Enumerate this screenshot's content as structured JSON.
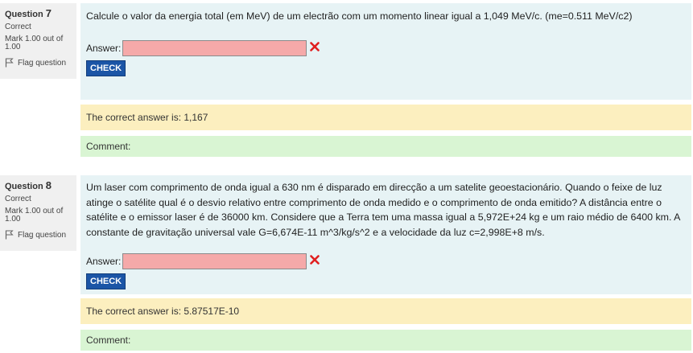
{
  "questions": [
    {
      "label": "Question",
      "number": "7",
      "state": "Correct",
      "grade": "Mark 1.00 out of 1.00",
      "flag_label": "Flag question",
      "text": "Calcule o valor da energia total (em MeV) de um electrão com um momento linear igual a 1,049 MeV/c. (me=0.511 MeV/c2)",
      "answer_label": "Answer:",
      "answer_value": "",
      "check_label": "CHECK",
      "correct_answer": "The correct answer is: 1,167",
      "comment": "Comment:"
    },
    {
      "label": "Question",
      "number": "8",
      "state": "Correct",
      "grade": "Mark 1.00 out of 1.00",
      "flag_label": "Flag question",
      "text": "Um laser com comprimento de onda igual a 630 nm é disparado em direcção a um satelite geoestacionário. Quando o feixe de luz atinge o satélite qual é o desvio relativo entre comprimento de onda medido e o comprimento de onda emitido? A distância entre o satélite e o emissor laser é de 36000 km. Considere que a Terra tem uma massa igual a 5,972E+24 kg e um raio médio de 6400 km. A constante de gravitação universal vale G=6,674E-11 m^3/kg/s^2 e a velocidade da luz c=2,998E+8 m/s.",
      "answer_label": "Answer:",
      "answer_value": "",
      "check_label": "CHECK",
      "correct_answer": "The correct answer is: 5.87517E-10",
      "comment": "Comment:"
    }
  ],
  "colors": {
    "info_bg": "#f0f0f0",
    "formulation_bg": "#e7f3f5",
    "outcome_bg": "#fcefbf",
    "comment_bg": "#d9f5d3",
    "incorrect_input_bg": "#f5a9a9",
    "check_button_bg": "#1b55a6",
    "incorrect_icon": "#e02020"
  },
  "icons": {
    "flag": "flag-outline-icon",
    "incorrect": "incorrect-x-icon"
  }
}
